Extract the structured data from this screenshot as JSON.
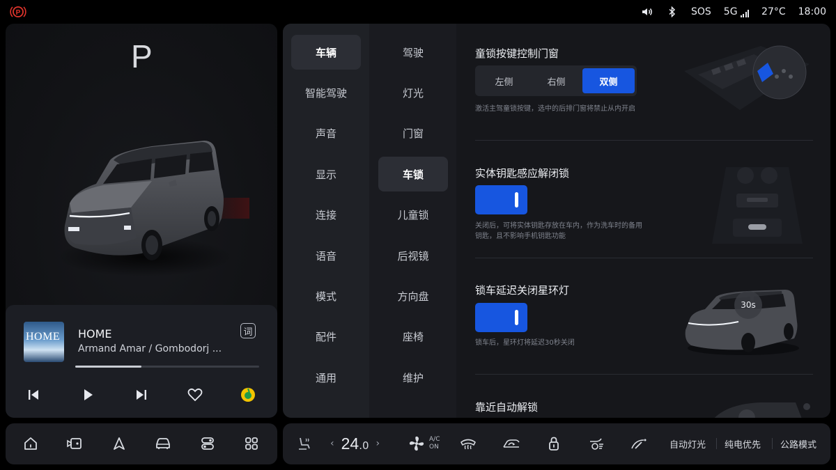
{
  "status": {
    "sos": "SOS",
    "network": "5G",
    "temperature": "27°C",
    "time": "18:00"
  },
  "vehicle": {
    "gear": "P"
  },
  "media": {
    "album_text": "HOME",
    "title": "HOME",
    "artist": "Armand Amar / Gombodorj ...",
    "lyrics_label": "词",
    "progress": 0.36
  },
  "settings_nav": {
    "column1": [
      "车辆",
      "智能驾驶",
      "声音",
      "显示",
      "连接",
      "语音",
      "模式",
      "配件",
      "通用"
    ],
    "column1_active": "车辆",
    "column2": [
      "驾驶",
      "灯光",
      "门窗",
      "车锁",
      "儿童锁",
      "后视镜",
      "方向盘",
      "座椅",
      "维护"
    ],
    "column2_active": "车锁"
  },
  "settings": {
    "child_lock": {
      "title": "童锁按键控制门窗",
      "options": [
        "左侧",
        "右侧",
        "双侧"
      ],
      "selected": "双侧",
      "description": "激活主驾童锁按键，选中的后排门窗将禁止从内开启"
    },
    "physical_key": {
      "title": "实体钥匙感应解闭锁",
      "enabled": true,
      "description_line1": "关闭后，可将实体钥匙存放在车内，作为洗车时的备用",
      "description_line2": "钥匙，且不影响手机钥匙功能"
    },
    "ring_light_delay": {
      "title": "锁车延迟关闭星环灯",
      "enabled": true,
      "description": "锁车后，星环灯将延迟30秒关闭",
      "badge": "30s"
    },
    "auto_unlock": {
      "title": "靠近自动解锁"
    }
  },
  "dock": {
    "temp_main": "24",
    "temp_decimal": ".0",
    "ac_line1": "A/C",
    "ac_line2": "ON",
    "auto_light": "自动灯光",
    "ev_priority": "纯电优先",
    "road_mode": "公路模式"
  }
}
